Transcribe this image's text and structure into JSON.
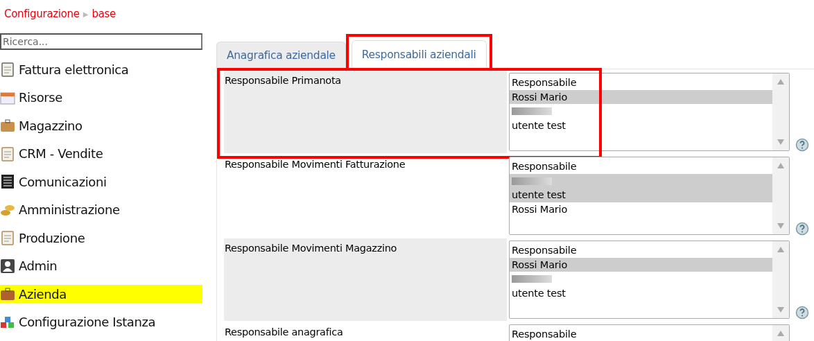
{
  "breadcrumb": {
    "items": [
      "Configurazione",
      "base"
    ],
    "separator": "▶"
  },
  "sidebar": {
    "search": {
      "placeholder": "Ricerca..."
    },
    "items": [
      {
        "label": "Fattura elettronica",
        "selected": false
      },
      {
        "label": "Risorse",
        "selected": false
      },
      {
        "label": "Magazzino",
        "selected": false
      },
      {
        "label": "CRM - Vendite",
        "selected": false
      },
      {
        "label": "Comunicazioni",
        "selected": false
      },
      {
        "label": "Amministrazione",
        "selected": false
      },
      {
        "label": "Produzione",
        "selected": false
      },
      {
        "label": "Admin",
        "selected": false
      },
      {
        "label": "Azienda",
        "selected": true
      },
      {
        "label": "Configurazione Istanza",
        "selected": false
      }
    ]
  },
  "tabs": [
    {
      "label": "Anagrafica aziendale",
      "selected": false,
      "highlighted": false
    },
    {
      "label": "Responsabili aziendali",
      "selected": true,
      "highlighted": true
    }
  ],
  "rows": [
    {
      "label": "Responsabile Primanota",
      "highlighted": true,
      "options": [
        {
          "kind": "text",
          "text": "Responsabile",
          "selected": false
        },
        {
          "kind": "text",
          "text": "Rossi Mario",
          "selected": true
        },
        {
          "kind": "redacted",
          "selected": false
        },
        {
          "kind": "text",
          "text": "utente test",
          "selected": false
        }
      ]
    },
    {
      "label": "Responsabile Movimenti Fatturazione",
      "highlighted": false,
      "options": [
        {
          "kind": "text",
          "text": "Responsabile",
          "selected": false
        },
        {
          "kind": "redacted",
          "selected": true
        },
        {
          "kind": "text",
          "text": "utente test",
          "selected": true
        },
        {
          "kind": "text",
          "text": "Rossi Mario",
          "selected": false
        }
      ]
    },
    {
      "label": "Responsabile Movimenti Magazzino",
      "highlighted": false,
      "options": [
        {
          "kind": "text",
          "text": "Responsabile",
          "selected": false
        },
        {
          "kind": "text",
          "text": "Rossi Mario",
          "selected": true
        },
        {
          "kind": "redacted",
          "selected": false
        },
        {
          "kind": "text",
          "text": "utente test",
          "selected": false
        }
      ]
    },
    {
      "label": "Responsabile anagrafica",
      "highlighted": false,
      "options": [
        {
          "kind": "text",
          "text": "Responsabile",
          "selected": false
        }
      ]
    }
  ]
}
